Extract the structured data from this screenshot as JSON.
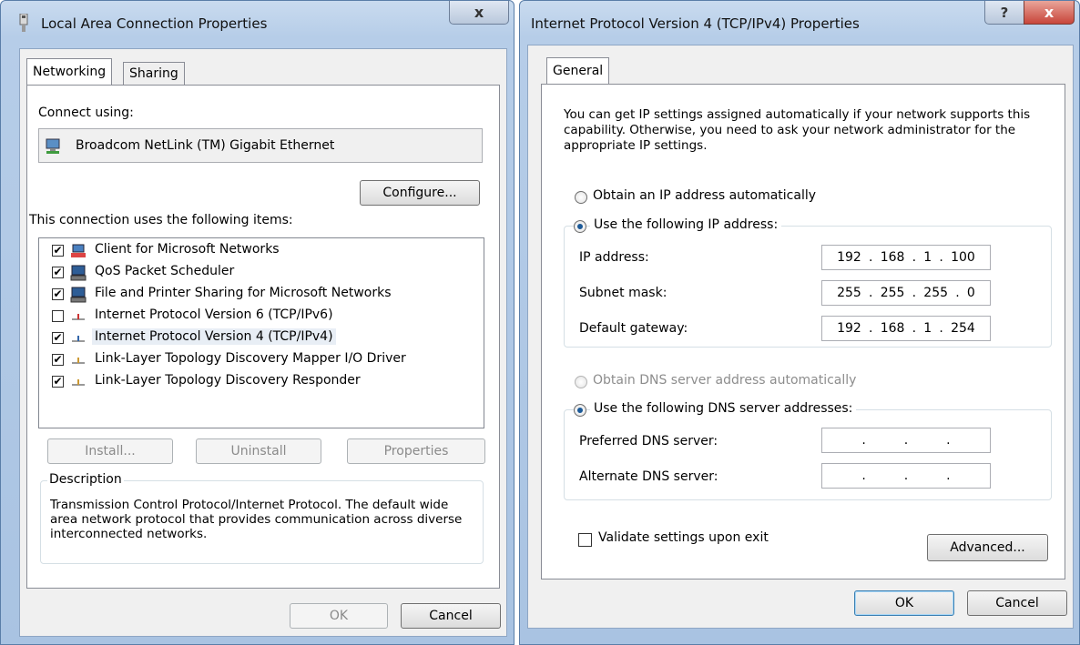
{
  "left_dialog": {
    "title": "Local Area Connection Properties",
    "close_label": "x",
    "tabs": [
      "Networking",
      "Sharing"
    ],
    "connect_using_label": "Connect using:",
    "adapter_name": "Broadcom NetLink (TM) Gigabit Ethernet",
    "configure_label": "Configure...",
    "items_label": "This connection uses the following items:",
    "items": [
      {
        "label": "Client for Microsoft Networks",
        "checked": "✔",
        "icon": "network-client-icon"
      },
      {
        "label": "QoS Packet Scheduler",
        "checked": "✔",
        "icon": "computer-icon"
      },
      {
        "label": "File and Printer Sharing for Microsoft Networks",
        "checked": "✔",
        "icon": "computer-icon"
      },
      {
        "label": "Internet Protocol Version 6 (TCP/IPv6)",
        "checked": "",
        "icon": "protocol-icon"
      },
      {
        "label": "Internet Protocol Version 4 (TCP/IPv4)",
        "checked": "✔",
        "icon": "protocol-icon"
      },
      {
        "label": "Link-Layer Topology Discovery Mapper I/O Driver",
        "checked": "✔",
        "icon": "protocol-icon"
      },
      {
        "label": "Link-Layer Topology Discovery Responder",
        "checked": "✔",
        "icon": "protocol-icon"
      }
    ],
    "install_label": "Install...",
    "uninstall_label": "Uninstall",
    "properties_label": "Properties",
    "description_title": "Description",
    "description_text": "Transmission Control Protocol/Internet Protocol. The default wide area network protocol that provides communication across diverse interconnected networks.",
    "ok_label": "OK",
    "cancel_label": "Cancel"
  },
  "right_dialog": {
    "title": "Internet Protocol Version 4 (TCP/IPv4) Properties",
    "help_label": "?",
    "close_label": "x",
    "tab": "General",
    "intro_text": "You can get IP settings assigned automatically if your network supports this capability. Otherwise, you need to ask your network administrator for the appropriate IP settings.",
    "obtain_ip_label": "Obtain an IP address automatically",
    "use_ip_label": "Use the following IP address:",
    "ip_address_label": "IP address:",
    "ip_address": [
      "192",
      "168",
      "1",
      "100"
    ],
    "subnet_label": "Subnet mask:",
    "subnet": [
      "255",
      "255",
      "255",
      "0"
    ],
    "gateway_label": "Default gateway:",
    "gateway": [
      "192",
      "168",
      "1",
      "254"
    ],
    "obtain_dns_label": "Obtain DNS server address automatically",
    "use_dns_label": "Use the following DNS server addresses:",
    "preferred_dns_label": "Preferred DNS server:",
    "alternate_dns_label": "Alternate DNS server:",
    "validate_label": "Validate settings upon exit",
    "advanced_label": "Advanced...",
    "ok_label": "OK",
    "cancel_label": "Cancel"
  },
  "colors": {
    "title_gradient_top": "#c9dbef",
    "close_button": "#c8453a",
    "selection": "#e8eef5"
  }
}
